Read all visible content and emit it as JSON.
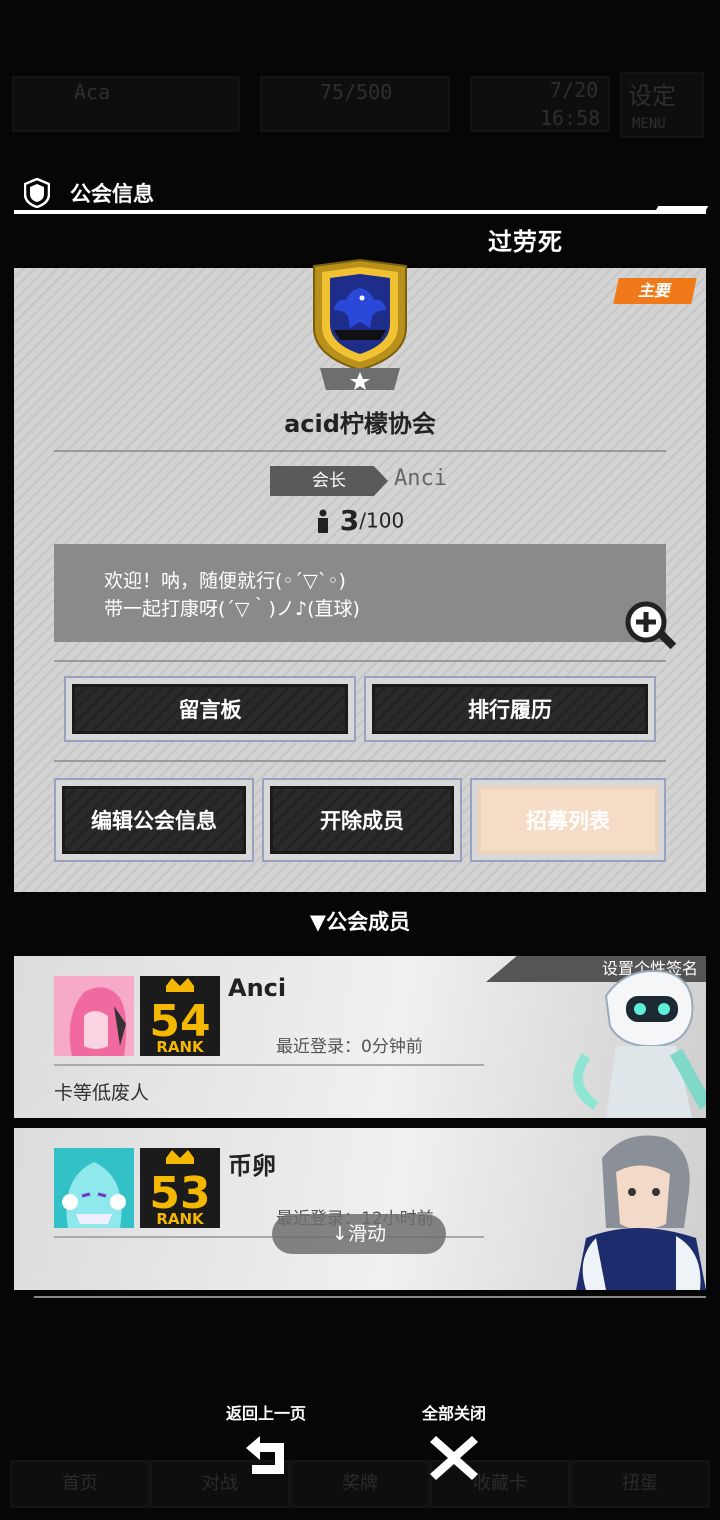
{
  "background": {
    "hud": {
      "level": "Aca",
      "stamina": "75/500",
      "count": "7/20",
      "time": "16:58",
      "settings": "设定",
      "menu": "MENU"
    },
    "nav": [
      "首页",
      "对战",
      "奖牌",
      "收藏卡",
      "扭蛋"
    ]
  },
  "header": {
    "title": "公会信息",
    "icon": "shield-icon"
  },
  "user": {
    "name": "过劳死"
  },
  "guild": {
    "tag": "主要",
    "name": "acid柠檬协会",
    "leader_label": "会长",
    "leader_name": "Anci",
    "members_current": "3",
    "members_max": "/100",
    "description": [
      "欢迎！呐，随便就行(◦´▽`◦)",
      "带一起打康呀(´▽｀)ノ♪(直球)"
    ],
    "buttons": {
      "message_board": "留言板",
      "ranking_history": "排行履历",
      "edit_info": "编辑公会信息",
      "kick_member": "开除成员",
      "recruit_list": "招募列表"
    }
  },
  "members_section": {
    "title": "▼公会成员"
  },
  "members": [
    {
      "name": "Anci",
      "rank": "54",
      "rank_label": "RANK",
      "last_login": "最近登录：0分钟前",
      "signature": "卡等低废人",
      "signature_button": "设置个性签名"
    },
    {
      "name": "币卵",
      "rank": "53",
      "rank_label": "RANK",
      "last_login": "最近登录：12小时前",
      "signature": ""
    }
  ],
  "scroll_hint": "↓滑动",
  "bottom_nav": {
    "back": "返回上一页",
    "close_all": "全部关闭"
  },
  "colors": {
    "accent": "#f07a1a",
    "panel": "#d3d3d3",
    "button_dark": "#2a2a2a",
    "rank_gold": "#f5b800"
  }
}
